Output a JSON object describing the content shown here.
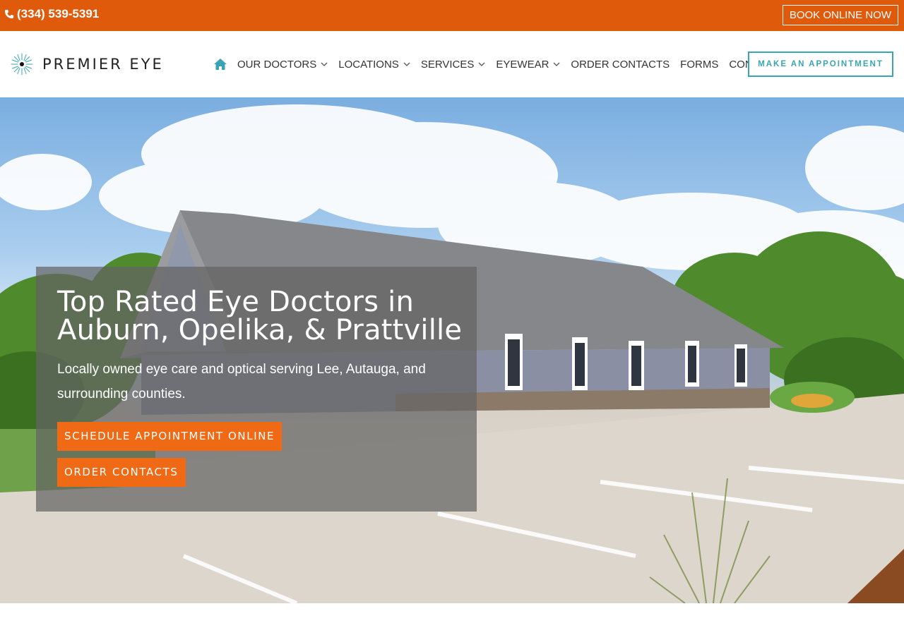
{
  "topbar": {
    "phone": "(334) 539-5391",
    "book_label": "BOOK ONLINE NOW"
  },
  "header": {
    "logo_text": "PREMIER EYE",
    "nav": [
      {
        "label": "OUR DOCTORS",
        "dropdown": true
      },
      {
        "label": "LOCATIONS",
        "dropdown": true
      },
      {
        "label": "SERVICES",
        "dropdown": true
      },
      {
        "label": "EYEWEAR",
        "dropdown": true
      },
      {
        "label": "ORDER CONTACTS",
        "dropdown": false
      },
      {
        "label": "FORMS",
        "dropdown": false
      },
      {
        "label": "CONTACT",
        "dropdown": false
      }
    ],
    "appointment_label": "MAKE AN APPOINTMENT"
  },
  "hero": {
    "title_line1": "Top Rated Eye Doctors in",
    "title_line2": "Auburn, Opelika, & Prattville",
    "subtitle": "Locally owned eye care and optical serving Lee, Autauga, and surrounding counties.",
    "schedule_label": "SCHEDULE APPOINTMENT ONLINE",
    "order_label": "ORDER CONTACTS"
  },
  "colors": {
    "brand_orange": "#e05a0c",
    "button_orange": "#f06a16",
    "accent_teal": "#3aa3b4"
  },
  "icons": {
    "phone": "phone-icon",
    "home": "home-icon",
    "chevron": "chevron-down-icon",
    "logo_mark": "starburst-eye-icon"
  }
}
